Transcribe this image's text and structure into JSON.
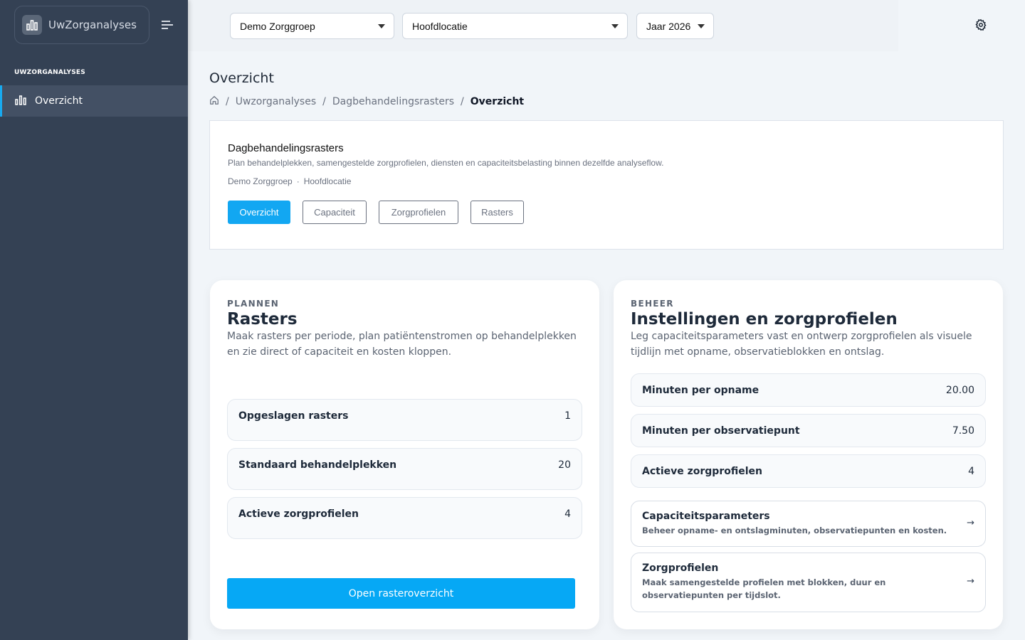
{
  "sidebar": {
    "brand": "UwZorganalyses",
    "section_label": "UWZORGANALYSES",
    "items": [
      {
        "label": "Overzicht",
        "icon": "bar-chart-icon",
        "active": true
      }
    ]
  },
  "topbar": {
    "org_select": "Demo Zorggroep",
    "location_select": "Hoofdlocatie",
    "year_select": "Jaar 2026"
  },
  "page": {
    "title": "Overzicht",
    "breadcrumb": [
      "Uwzorganalyses",
      "Dagbehandelingsrasters",
      "Overzicht"
    ]
  },
  "info": {
    "title": "Dagbehandelingsrasters",
    "description": "Plan behandelplekken, samengestelde zorgprofielen, diensten en capaciteitsbelasting binnen dezelfde analyseflow.",
    "org": "Demo Zorggroep",
    "location": "Hoofdlocatie",
    "tabs": [
      "Overzicht",
      "Capaciteit",
      "Zorgprofielen",
      "Rasters"
    ],
    "active_tab": "Overzicht"
  },
  "plannen": {
    "eyebrow": "PLANNEN",
    "title": "Rasters",
    "description": "Maak rasters per periode, plan patiëntenstromen op behandelplekken en zie direct of capaciteit en kosten kloppen.",
    "stats": [
      {
        "label": "Opgeslagen rasters",
        "value": "1"
      },
      {
        "label": "Standaard behandelplekken",
        "value": "20"
      },
      {
        "label": "Actieve zorgprofielen",
        "value": "4"
      }
    ],
    "button": "Open rasteroverzicht"
  },
  "beheer": {
    "eyebrow": "BEHEER",
    "title": "Instellingen en zorgprofielen",
    "description": "Leg capaciteitsparameters vast en ontwerp zorgprofielen als visuele tijdlijn met opname, observatieblokken en ontslag.",
    "stats": [
      {
        "label": "Minuten per opname",
        "value": "20.00"
      },
      {
        "label": "Minuten per observatiepunt",
        "value": "7.50"
      },
      {
        "label": "Actieve zorgprofielen",
        "value": "4"
      }
    ],
    "links": [
      {
        "title": "Capaciteitsparameters",
        "description": "Beheer opname- en ontslagminuten, observatiepunten en kosten.",
        "arrow": "→"
      },
      {
        "title": "Zorgprofielen",
        "description": "Maak samengestelde profielen met blokken, duur en observatiepunten per tijdslot.",
        "arrow": "→"
      }
    ]
  },
  "colors": {
    "sidebar_bg": "#344154",
    "accent": "#12a7f2",
    "page_bg": "#f1f5f9"
  }
}
